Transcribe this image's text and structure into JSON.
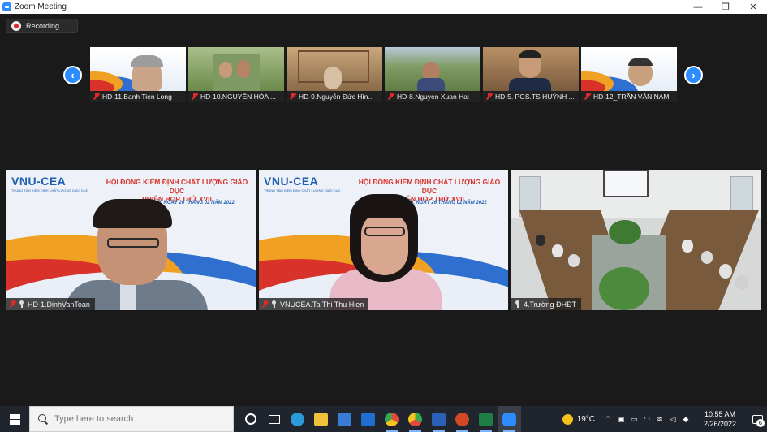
{
  "window": {
    "title": "Zoom Meeting",
    "controls": [
      "—",
      "❐",
      "✕"
    ]
  },
  "recording": {
    "label": "Recording..."
  },
  "nav": {
    "prev": "‹",
    "next": "›"
  },
  "thumbnails": [
    {
      "name": "HD-11.Banh Tien Long",
      "bg": "#dfe8f4"
    },
    {
      "name": "HD-10.NGUYỄN HÒA ...",
      "bg": "#8aa060"
    },
    {
      "name": "HD-9.Nguyễn Đức Hìn...",
      "bg": "#b58e63"
    },
    {
      "name": "HD-8.Nguyen Xuan Hai",
      "bg": "#6f8f55"
    },
    {
      "name": "HD-5. PGS.TS HUỲNH ...",
      "bg": "#8a6b4e"
    },
    {
      "name": "HD-12_TRẦN VĂN NAM",
      "bg": "#dfe8f4"
    }
  ],
  "banner": {
    "logo": "VNU-CEA",
    "logo_sub": "TRUNG TÂM KIỂM ĐỊNH CHẤT LƯỢNG GIÁO DỤC",
    "title_line1": "HỘI ĐỒNG KIỂM ĐỊNH CHẤT LƯỢNG GIÁO DỤC",
    "title_line2": "PHIÊN HỌP THỨ XVII",
    "date": "HÀ NỘI, NGÀY 26 THÁNG 02 NĂM 2022"
  },
  "tiles": [
    {
      "name": "HD-1.DinhVanToan",
      "muted": true
    },
    {
      "name": "VNUCEA.Ta Thi Thu Hien",
      "muted": true
    },
    {
      "name": "4.Trường ĐHĐT",
      "muted": false
    }
  ],
  "taskbar": {
    "search_placeholder": "Type here to search",
    "weather_temp": "19°C",
    "time": "10:55 AM",
    "date": "2/26/2022",
    "notification_count": "6",
    "apps": [
      {
        "name": "task-view-icon",
        "color": "#20242c"
      },
      {
        "name": "widgets-icon",
        "color": "#20242c"
      },
      {
        "name": "edge-icon",
        "color": "#2a9ad8"
      },
      {
        "name": "file-explorer-icon",
        "color": "#f2c13b"
      },
      {
        "name": "store-icon",
        "color": "#3a7bd5"
      },
      {
        "name": "mail-icon",
        "color": "#1f6fd0"
      },
      {
        "name": "chrome-icon",
        "color": "#e24a3b"
      },
      {
        "name": "chrome-icon-2",
        "color": "#34a853"
      },
      {
        "name": "word-icon",
        "color": "#2b5fb8"
      },
      {
        "name": "powerpoint-icon",
        "color": "#d24726"
      },
      {
        "name": "excel-icon",
        "color": "#1e7e45"
      },
      {
        "name": "zoom-icon",
        "color": "#2d8cff"
      }
    ]
  }
}
